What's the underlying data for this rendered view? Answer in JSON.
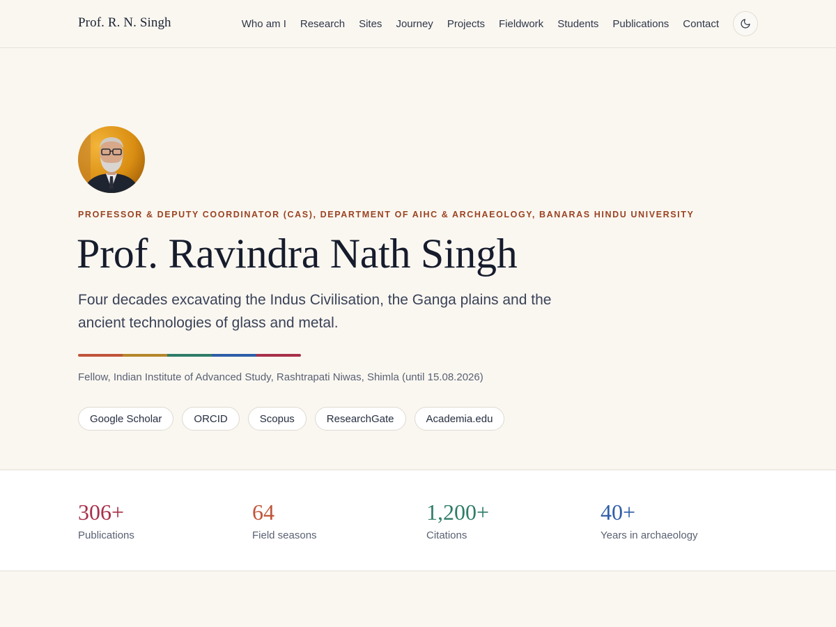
{
  "header": {
    "brand": "Prof. R. N. Singh",
    "nav": [
      "Who am I",
      "Research",
      "Sites",
      "Journey",
      "Projects",
      "Fieldwork",
      "Students",
      "Publications",
      "Contact"
    ],
    "theme_toggle_icon": "moon-icon"
  },
  "hero": {
    "avatar_icon": "profile-photo",
    "kicker": "PROFESSOR & DEPUTY COORDINATOR (CAS), DEPARTMENT OF AIHC & ARCHAEOLOGY, BANARAS HINDU UNIVERSITY",
    "name": "Prof. Ravindra Nath Singh",
    "tagline": "Four decades excavating the Indus Civilisation, the Ganga plains and the ancient technologies of glass and metal.",
    "colorbar": [
      "#c0553a",
      "#b5862a",
      "#2f7d68",
      "#2f5ea8",
      "#a8304a"
    ],
    "fellowship": "Fellow, Indian Institute of Advanced Study, Rashtrapati Niwas, Shimla (until 15.08.2026)",
    "links": [
      "Google Scholar",
      "ORCID",
      "Scopus",
      "ResearchGate",
      "Academia.edu"
    ]
  },
  "stats": [
    {
      "value": "306+",
      "label": "Publications",
      "color": "#a8304a"
    },
    {
      "value": "64",
      "label": "Field seasons",
      "color": "#c0553a"
    },
    {
      "value": "1,200+",
      "label": "Citations",
      "color": "#2f7d68"
    },
    {
      "value": "40+",
      "label": "Years in archaeology",
      "color": "#2f5ea8"
    }
  ],
  "colors": {
    "background": "#faf7f1",
    "kicker": "#9a4322",
    "heading": "#161c2c"
  }
}
